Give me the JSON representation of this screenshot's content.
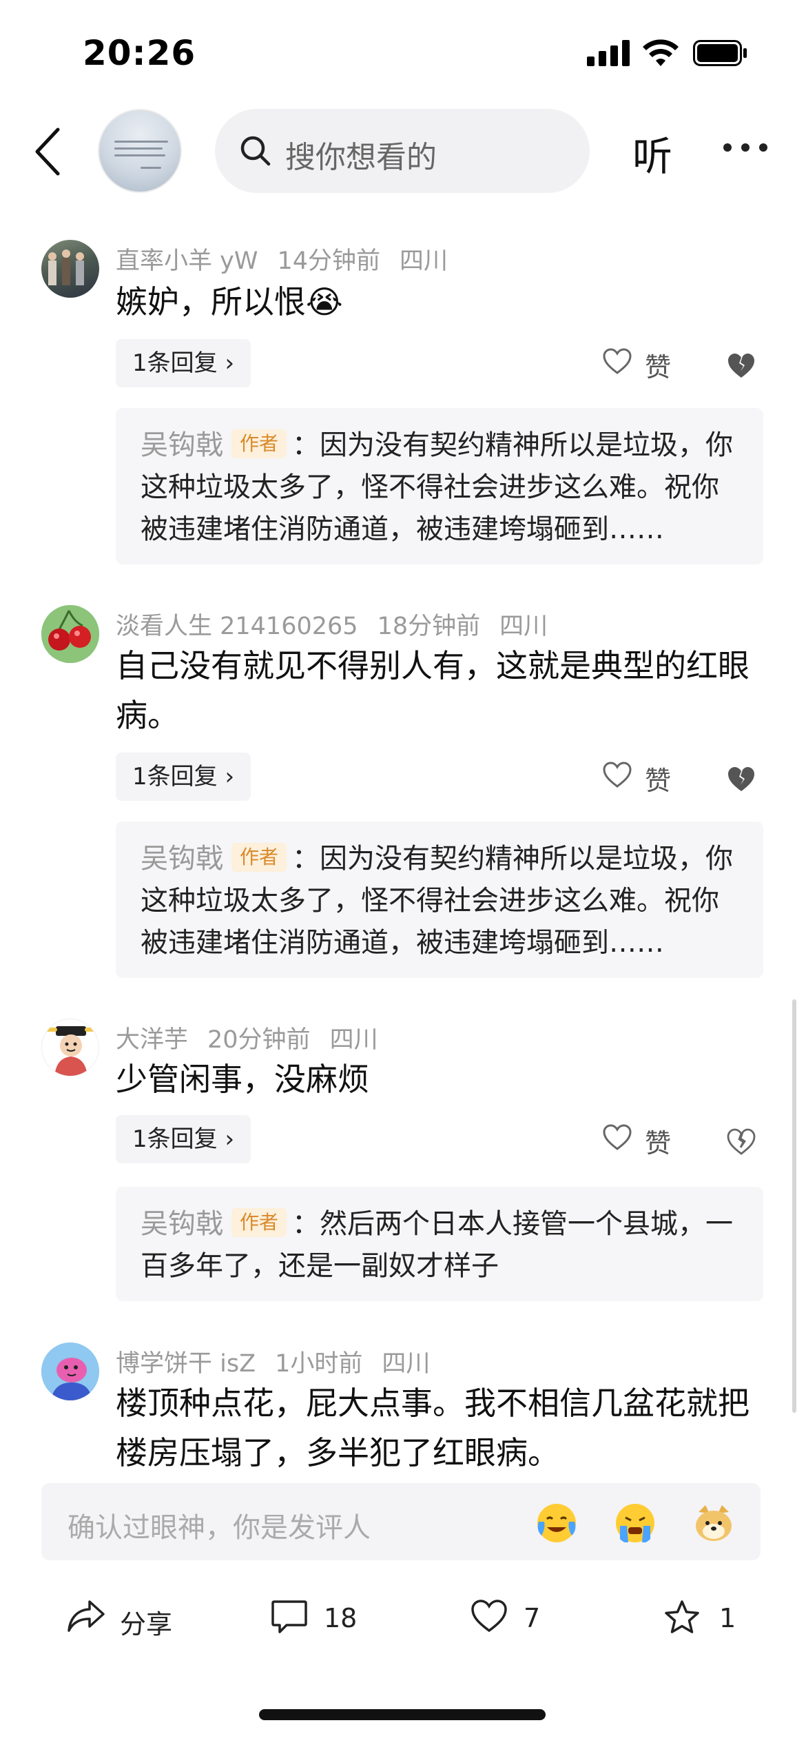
{
  "status_bar": {
    "time": "20:26"
  },
  "header": {
    "search_placeholder": "搜你想看的",
    "listen_label": "听"
  },
  "comments": [
    {
      "username": "直率小羊 yW",
      "time": "14分钟前",
      "location": "四川",
      "text": "嫉妒，所以恨😭",
      "reply_label": "1条回复 ›",
      "like_label": "赞",
      "reply": {
        "author": "吴钩戟",
        "badge": "作者",
        "text": "：因为没有契约精神所以是垃圾，你这种垃圾太多了，怪不得社会进步这么难。祝你被违建堵住消防通道，被违建垮塌砸到……"
      }
    },
    {
      "username": "淡看人生 214160265",
      "time": "18分钟前",
      "location": "四川",
      "text": "自己没有就见不得别人有，这就是典型的红眼病。",
      "reply_label": "1条回复 ›",
      "like_label": "赞",
      "reply": {
        "author": "吴钩戟",
        "badge": "作者",
        "text": "：因为没有契约精神所以是垃圾，你这种垃圾太多了，怪不得社会进步这么难。祝你被违建堵住消防通道，被违建垮塌砸到……"
      }
    },
    {
      "username": "大洋芋",
      "time": "20分钟前",
      "location": "四川",
      "text": "少管闲事，没麻烦",
      "reply_label": "1条回复 ›",
      "like_label": "赞",
      "reply": {
        "author": "吴钩戟",
        "badge": "作者",
        "text": "：然后两个日本人接管一个县城，一百多年了，还是一副奴才样子"
      }
    },
    {
      "username": "博学饼干 isZ",
      "time": "1小时前",
      "location": "四川",
      "text": "楼顶种点花，屁大点事。我不相信几盆花就把楼房压塌了，多半犯了红眼病。"
    }
  ],
  "input_bar": {
    "placeholder": "确认过眼神，你是发评人"
  },
  "actions": {
    "share_label": "分享",
    "comment_count": "18",
    "like_count": "7",
    "favorite_count": "1"
  }
}
